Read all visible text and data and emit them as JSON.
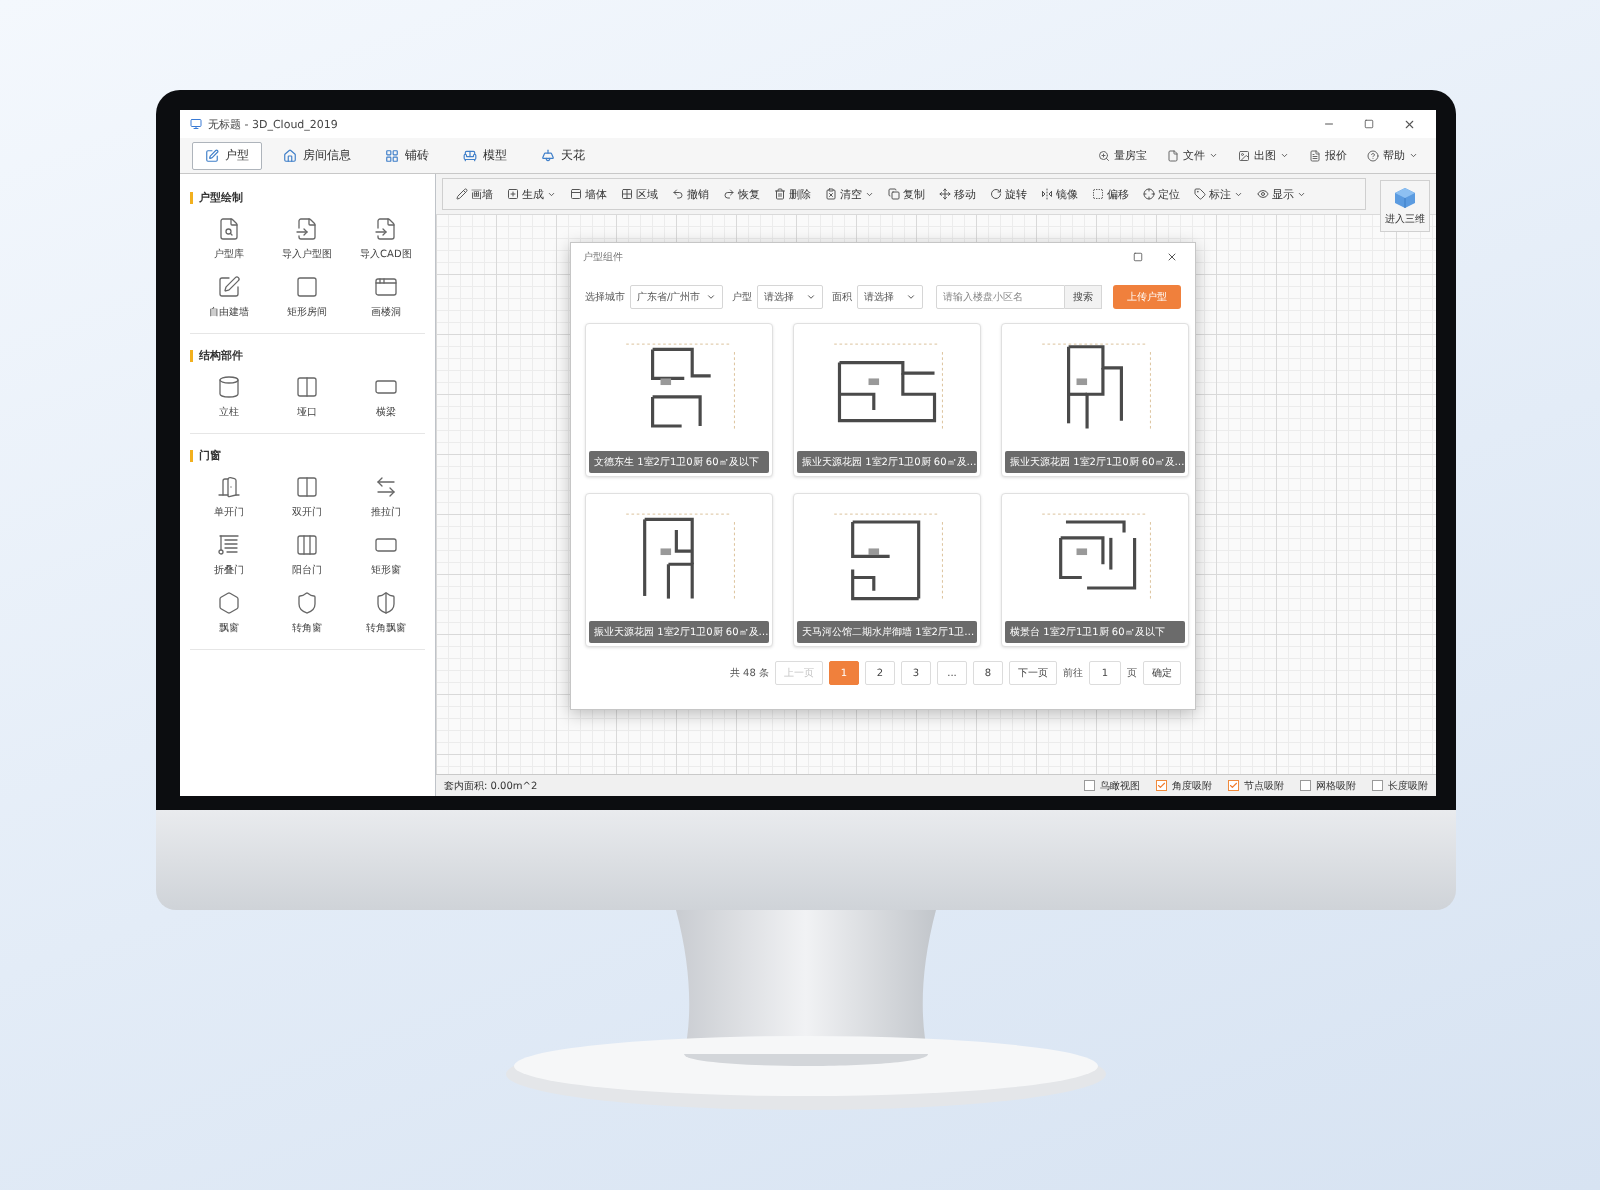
{
  "window": {
    "title": "无标题 - 3D_Cloud_2019"
  },
  "tabs": [
    {
      "label": "户型",
      "selected": true
    },
    {
      "label": "房间信息",
      "selected": false
    },
    {
      "label": "铺砖",
      "selected": false
    },
    {
      "label": "模型",
      "selected": false
    },
    {
      "label": "天花",
      "selected": false
    }
  ],
  "menus": [
    {
      "label": "量房宝",
      "dropdown": false
    },
    {
      "label": "文件",
      "dropdown": true
    },
    {
      "label": "出图",
      "dropdown": true
    },
    {
      "label": "报价",
      "dropdown": false
    },
    {
      "label": "帮助",
      "dropdown": true
    }
  ],
  "toolbar": [
    {
      "label": "画墙",
      "dropdown": false
    },
    {
      "label": "生成",
      "dropdown": true
    },
    {
      "label": "墙体",
      "dropdown": false
    },
    {
      "label": "区域",
      "dropdown": false
    },
    {
      "label": "撤销",
      "dropdown": false
    },
    {
      "label": "恢复",
      "dropdown": false
    },
    {
      "label": "删除",
      "dropdown": false
    },
    {
      "label": "清空",
      "dropdown": true
    },
    {
      "label": "复制",
      "dropdown": false
    },
    {
      "label": "移动",
      "dropdown": false
    },
    {
      "label": "旋转",
      "dropdown": false
    },
    {
      "label": "镜像",
      "dropdown": false
    },
    {
      "label": "偏移",
      "dropdown": false
    },
    {
      "label": "定位",
      "dropdown": false
    },
    {
      "label": "标注",
      "dropdown": true
    },
    {
      "label": "显示",
      "dropdown": true
    }
  ],
  "enter_3d": "进入三维",
  "sidebar": {
    "sections": [
      {
        "title": "户型绘制",
        "items": [
          "户型库",
          "导入户型图",
          "导入CAD图",
          "自由建墙",
          "矩形房间",
          "画楼洞"
        ]
      },
      {
        "title": "结构部件",
        "items": [
          "立柱",
          "垭口",
          "横梁"
        ]
      },
      {
        "title": "门窗",
        "items": [
          "单开门",
          "双开门",
          "推拉门",
          "折叠门",
          "阳台门",
          "矩形窗",
          "飘窗",
          "转角窗",
          "转角飘窗"
        ]
      }
    ]
  },
  "dialog": {
    "title": "户型组件",
    "filters": [
      {
        "label": "选择城市",
        "value": "广东省/广州市"
      },
      {
        "label": "户型",
        "value": "请选择"
      },
      {
        "label": "面积",
        "value": "请选择"
      }
    ],
    "search": {
      "placeholder": "请输入楼盘小区名",
      "button": "搜索"
    },
    "upload_button": "上传户型",
    "cards": [
      "文德东生 1室2厅1卫0厨 60㎡及以下",
      "振业天源花园 1室2厅1卫0厨 60㎡及…",
      "振业天源花园 1室2厅1卫0厨 60㎡及…",
      "振业天源花园 1室2厅1卫0厨 60㎡及…",
      "天马河公馆二期水岸御墙 1室2厅1卫…",
      "横景台 1室2厅1卫1厨 60㎡及以下"
    ],
    "pagination": {
      "total": "共 48 条",
      "prev": {
        "label": "上一页",
        "disabled": true
      },
      "pages": [
        {
          "label": "1",
          "selected": true
        },
        {
          "label": "2",
          "selected": false
        },
        {
          "label": "3",
          "selected": false
        },
        {
          "label": "...",
          "selected": false
        },
        {
          "label": "8",
          "selected": false
        }
      ],
      "next": {
        "label": "下一页",
        "disabled": false
      },
      "goto_label": "前往",
      "goto_value": "1",
      "page_suffix": "页",
      "confirm": "确定"
    }
  },
  "status_bar": {
    "area": "套内面积: 0.00m^2",
    "toggles": [
      {
        "label": "鸟瞰视图",
        "checked": false
      },
      {
        "label": "角度吸附",
        "checked": true
      },
      {
        "label": "节点吸附",
        "checked": true
      },
      {
        "label": "网格吸附",
        "checked": false
      },
      {
        "label": "长度吸附",
        "checked": false
      }
    ]
  }
}
